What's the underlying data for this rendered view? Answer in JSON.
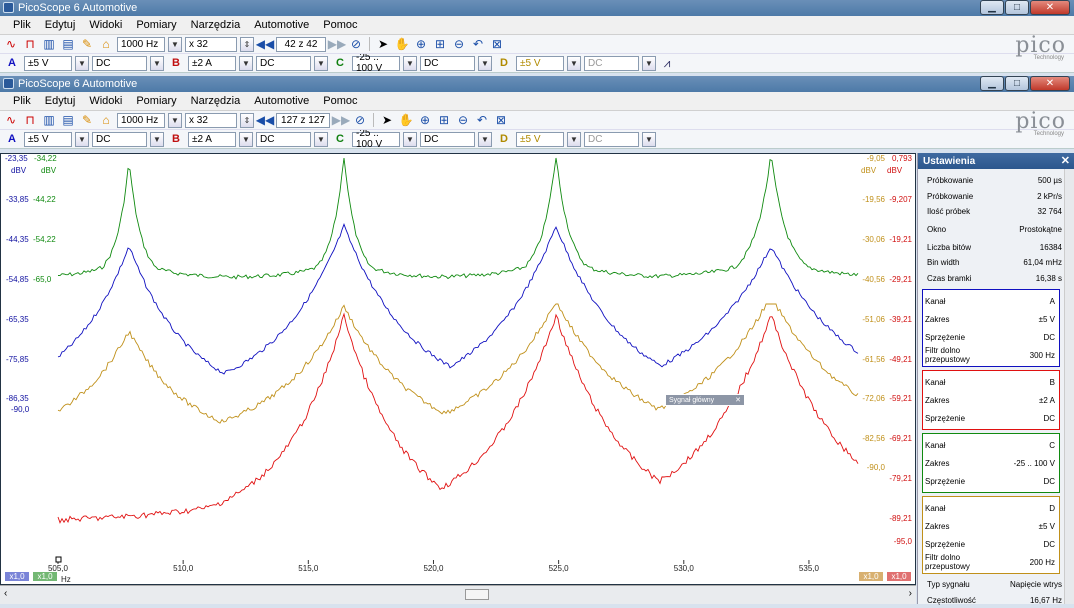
{
  "windows": [
    {
      "title": "PicoScope 6 Automotive",
      "timebase": "1000 Hz",
      "zoom": "x 32",
      "page": "42 z 42"
    },
    {
      "title": "PicoScope 6 Automotive",
      "timebase": "1000 Hz",
      "zoom": "x 32",
      "page": "127 z 127"
    }
  ],
  "menu": [
    "Plik",
    "Edytuj",
    "Widoki",
    "Pomiary",
    "Narzędzia",
    "Automotive",
    "Pomoc"
  ],
  "logo": "pico",
  "logo_sub": "Technology",
  "channels": [
    {
      "tag": "A",
      "range": "±5 V",
      "coupling": "DC"
    },
    {
      "tag": "B",
      "range": "±2 A",
      "coupling": "DC"
    },
    {
      "tag": "C",
      "range": "-25 .. 100 V",
      "coupling": "DC"
    },
    {
      "tag": "D",
      "range": "±5 V",
      "coupling": "DC"
    }
  ],
  "plot": {
    "x_ticks": [
      "505,0",
      "510,0",
      "515,0",
      "520,0",
      "525,0",
      "530,0",
      "535,0"
    ],
    "x_unit": "Hz",
    "left_axis_blue": [
      "-23,35",
      "-33,85",
      "-44,35",
      "-54,85",
      "-65,35",
      "-75,85",
      "-86,35"
    ],
    "left_axis_green": [
      "-34,22",
      "-44,22",
      "-54,22",
      "-65,0"
    ],
    "left_blue_bottom": "-90,0",
    "left_unit_blue": "dBV",
    "left_unit_green": "dBV",
    "right_axis_orange": [
      "-9,05",
      "-19,56",
      "-30,06",
      "-40,56",
      "-51,06",
      "-61,56",
      "-72,06",
      "-82,56",
      "-90,0"
    ],
    "right_axis_red": [
      "0,793",
      "-9,207",
      "-19,21",
      "-29,21",
      "-39,21",
      "-49,21",
      "-59,21",
      "-69,21",
      "-79,21",
      "-89,21",
      "-95,0"
    ],
    "right_unit_orange": "dBV",
    "right_unit_red": "dBV",
    "scale_badges": [
      "x1,0",
      "x1,0",
      "x1,0",
      "x1,0"
    ],
    "float_label": "Sygnał główny"
  },
  "colors": {
    "a": "#1010c0",
    "b": "#e01010",
    "c": "#108a10",
    "d": "#c0901a"
  },
  "chart_data": {
    "type": "line",
    "x_range": [
      505.0,
      537.0
    ],
    "xlabel": "Hz",
    "grid": false,
    "series": [
      {
        "name": "A",
        "peaks_hz": [
          509.5,
          516.8,
          525.0,
          533.3
        ],
        "floor_dbv": -81
      },
      {
        "name": "B",
        "peaks_hz": [
          516.8,
          525.0,
          533.3
        ],
        "floor_dbv": -87
      },
      {
        "name": "C",
        "peaks_hz": [
          509.5,
          516.8,
          525.0,
          533.3
        ],
        "floor_dbv": -65
      },
      {
        "name": "D",
        "peaks_hz": [
          509.5,
          516.8,
          525.0,
          533.3
        ],
        "floor_dbv": -77
      }
    ]
  },
  "settings": {
    "title": "Ustawienia",
    "general": [
      [
        "Próbkowanie",
        "500 µs"
      ],
      [
        "Próbkowanie",
        "2 kPr/s"
      ],
      [
        "Ilość próbek",
        "32 764"
      ],
      [
        "Okno",
        "Prostokątne"
      ],
      [
        "Liczba bitów",
        "16384"
      ],
      [
        "Bin width",
        "61,04 mHz"
      ],
      [
        "Czas bramki",
        "16,38 s"
      ]
    ],
    "boxes": [
      {
        "rows": [
          [
            "Kanał",
            "A"
          ],
          [
            "Zakres",
            "±5 V"
          ],
          [
            "Sprzężenie",
            "DC"
          ],
          [
            "Filtr dolno przepustowy",
            "300 Hz"
          ]
        ]
      },
      {
        "rows": [
          [
            "Kanał",
            "B"
          ],
          [
            "Zakres",
            "±2 A"
          ],
          [
            "Sprzężenie",
            "DC"
          ]
        ]
      },
      {
        "rows": [
          [
            "Kanał",
            "C"
          ],
          [
            "Zakres",
            "-25 .. 100 V"
          ],
          [
            "Sprzężenie",
            "DC"
          ]
        ]
      },
      {
        "rows": [
          [
            "Kanał",
            "D"
          ],
          [
            "Zakres",
            "±5 V"
          ],
          [
            "Sprzężenie",
            "DC"
          ],
          [
            "Filtr dolno przepustowy",
            "200 Hz"
          ]
        ]
      }
    ],
    "footer": [
      [
        "Typ sygnału",
        "Napięcie wtrys"
      ],
      [
        "Częstotliwość",
        "16,67 Hz"
      ]
    ]
  }
}
